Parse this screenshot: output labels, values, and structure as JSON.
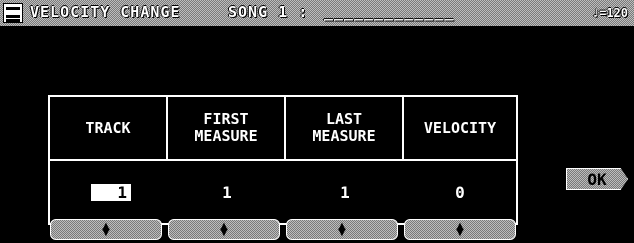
{
  "title_bar": {
    "title": "VELOCITY CHANGE",
    "song_label": "SONG 1 :",
    "song_name": "_____________",
    "tempo": "♩=120"
  },
  "table": {
    "headers": [
      "TRACK",
      "FIRST\nMEASURE",
      "LAST\nMEASURE",
      "VELOCITY"
    ],
    "values": {
      "track": "1",
      "first_measure": "1",
      "last_measure": "1",
      "velocity": "0"
    }
  },
  "steppers": {
    "icon_up": "▲",
    "icon_down": "▼"
  },
  "ok_button": "OK"
}
